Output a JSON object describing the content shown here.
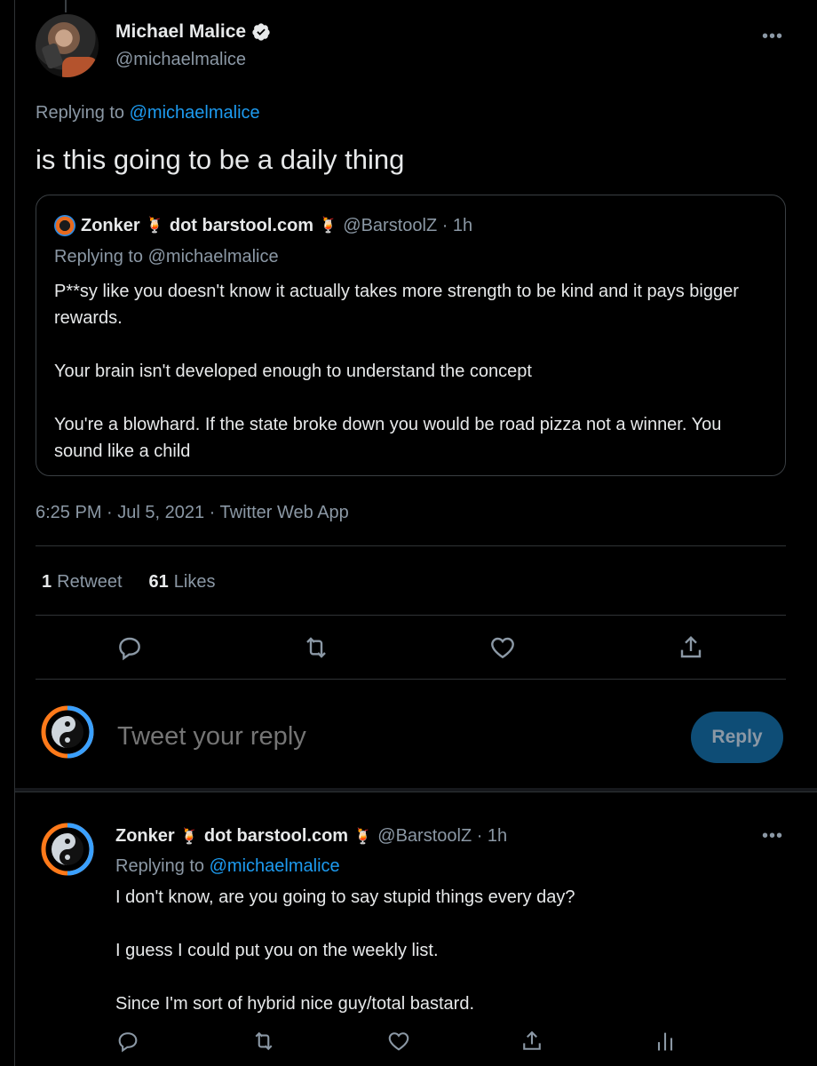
{
  "main_tweet": {
    "author_name": "Michael Malice",
    "author_handle": "@michaelmalice",
    "replying_prefix": "Replying to",
    "replying_handle": "@michaelmalice",
    "text": "is this going to be a daily thing",
    "timestamp": "6:25 PM · Jul 5, 2021 · Twitter Web App",
    "retweets_count": "1",
    "retweets_label": "Retweet",
    "likes_count": "61",
    "likes_label": "Likes"
  },
  "quoted_tweet": {
    "name_part1": "Zonker",
    "name_part2": "dot barstool.com",
    "drink_emoji": "🍹",
    "handle_time": "@BarstoolZ · 1h",
    "replying": "Replying to @michaelmalice",
    "paragraphs": [
      "P**sy like you doesn't know it actually takes more strength to be kind and it pays bigger rewards.",
      "Your brain isn't developed enough to understand the concept",
      "You're a blowhard. If the state broke down you would be road pizza not a winner. You sound like a child"
    ]
  },
  "composer": {
    "placeholder": "Tweet your reply",
    "button_label": "Reply"
  },
  "reply_tweet": {
    "name_part1": "Zonker",
    "name_part2": "dot barstool.com",
    "drink_emoji": "🍹",
    "handle_time": "@BarstoolZ · 1h",
    "replying_prefix": "Replying to",
    "replying_handle": "@michaelmalice",
    "paragraphs": [
      "I don't know, are you going to say stupid things every day?",
      "I guess I could put you on the weekly list.",
      "Since I'm sort of hybrid nice guy/total bastard."
    ]
  },
  "icons": {
    "more": "more-icon",
    "reply": "reply-icon",
    "retweet": "retweet-icon",
    "like": "heart-icon",
    "share": "share-icon",
    "analytics": "analytics-icon",
    "verified": "verified-badge-icon"
  },
  "colors": {
    "background": "#000000",
    "link": "#1d9bf0",
    "secondary_text": "#8b98a5",
    "primary_text": "#e7e9ea",
    "reply_button": "#0e4d76"
  }
}
